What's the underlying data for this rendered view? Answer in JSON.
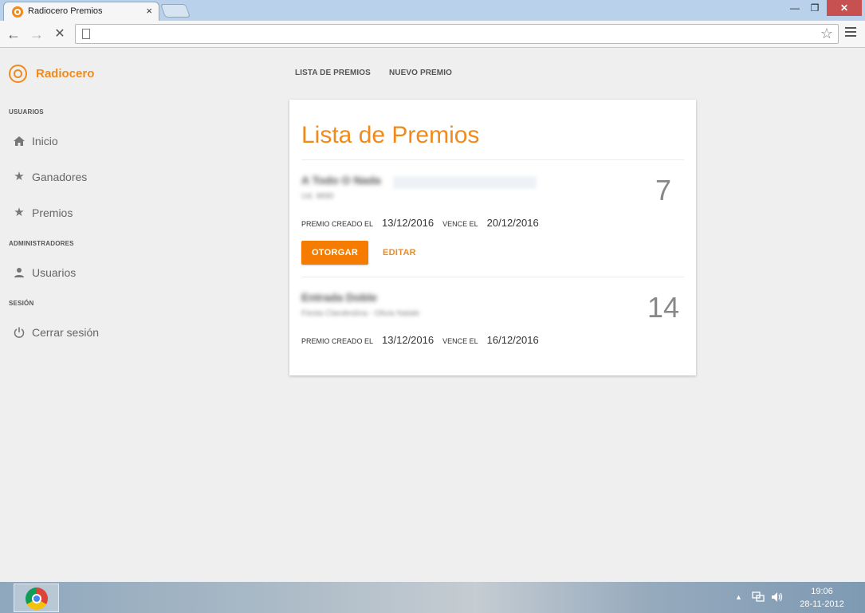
{
  "browser": {
    "tab_title": "Radiocero Premios",
    "tab_close": "×",
    "window_buttons": {
      "minimize": "—",
      "restore": "❐",
      "close": "✕"
    },
    "address": ""
  },
  "sidebar": {
    "brand": "Radiocero",
    "sections": [
      {
        "label": "USUARIOS"
      },
      {
        "label": "ADMINISTRADORES"
      },
      {
        "label": "SESIÓN"
      }
    ],
    "items": [
      {
        "label": "Inicio",
        "icon": "home-icon"
      },
      {
        "label": "Ganadores",
        "icon": "star-icon"
      },
      {
        "label": "Premios",
        "icon": "star-icon"
      },
      {
        "label": "Usuarios",
        "icon": "person-icon"
      },
      {
        "label": "Cerrar sesión",
        "icon": "power-icon"
      }
    ]
  },
  "topnav": {
    "list": "LISTA DE PREMIOS",
    "new": "NUEVO PREMIO"
  },
  "card": {
    "title": "Lista de Premios",
    "prizes": [
      {
        "name": "A Todo O Nada",
        "subtitle": "Ud. 9890",
        "quantity": "7",
        "created_label": "PREMIO CREADO EL",
        "created": "13/12/2016",
        "expires_label": "VENCE EL",
        "expires": "20/12/2016",
        "award_label": "OTORGAR",
        "edit_label": "EDITAR"
      },
      {
        "name": "Entrada Doble",
        "subtitle": "Fiesta Clandestina - Olivia Natale",
        "quantity": "14",
        "created_label": "PREMIO CREADO EL",
        "created": "13/12/2016",
        "expires_label": "VENCE EL",
        "expires": "16/12/2016"
      }
    ]
  },
  "taskbar": {
    "time": "19:06",
    "date": "28-11-2012"
  },
  "colors": {
    "accent": "#f08a1c",
    "button": "#f57c00",
    "background": "#efefef"
  }
}
